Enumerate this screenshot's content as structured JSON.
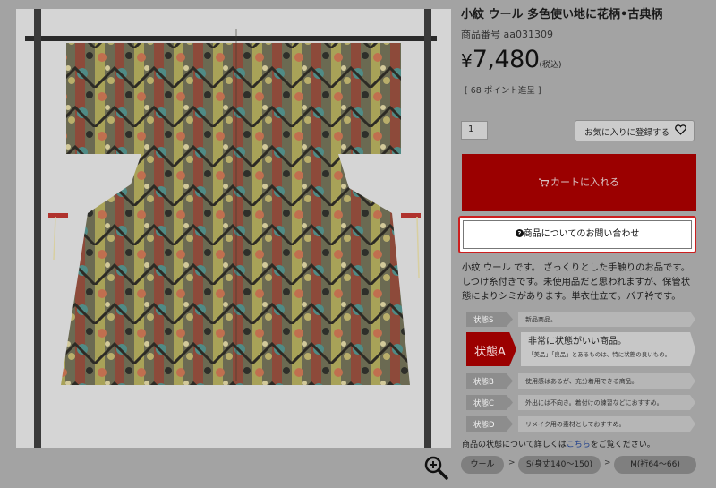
{
  "product": {
    "title": "小紋 ウール 多色使い地に花柄•古典柄",
    "sku": "商品番号 aa031309",
    "price_symbol": "¥",
    "price": "7,480",
    "price_tax": "(税込)",
    "points": "[ 68 ポイント進呈 ]",
    "quantity": "1"
  },
  "actions": {
    "favorite_label": "お気に入りに登録する",
    "cart_label": "カートに入れる",
    "inquiry_label": "商品についてのお問い合わせ"
  },
  "description": "小紋 ウール です。 ざっくりとした手触りのお品です。しつけ糸付きです。未使用品だと思われますが、保管状態によりシミがあります。単衣仕立て。バチ衿です。",
  "condition": {
    "rows": [
      {
        "tag": "状態S",
        "text": "新品商品。"
      },
      {
        "tag": "状態A",
        "text": "非常に状態がいい商品。",
        "sub": "「美品」「良品」とあるものは、特に状態の良いもの。"
      },
      {
        "tag": "状態B",
        "text": "使用感はあるが、充分着用できる商品。"
      },
      {
        "tag": "状態C",
        "text": "外出には不向き。着付けの練習などにおすすめ。"
      },
      {
        "tag": "状態D",
        "text": "リメイク用の素材としておすすめ。"
      }
    ],
    "link_prefix": "商品の状態について詳しくは",
    "link_text": "こちら",
    "link_suffix": "をご覧ください。"
  },
  "breadcrumbs": {
    "items": [
      "ウール",
      "S(身丈140～150)",
      "M(裄64～66)"
    ],
    "separator": ">"
  },
  "colors": {
    "accent_red": "#9b0000",
    "highlight_border": "#cc1f1f",
    "link": "#1e3f8c"
  },
  "icons": {
    "favorite": "heart-icon",
    "cart": "cart-icon",
    "inquiry": "question-circle-icon",
    "zoom": "zoom-in-icon"
  }
}
